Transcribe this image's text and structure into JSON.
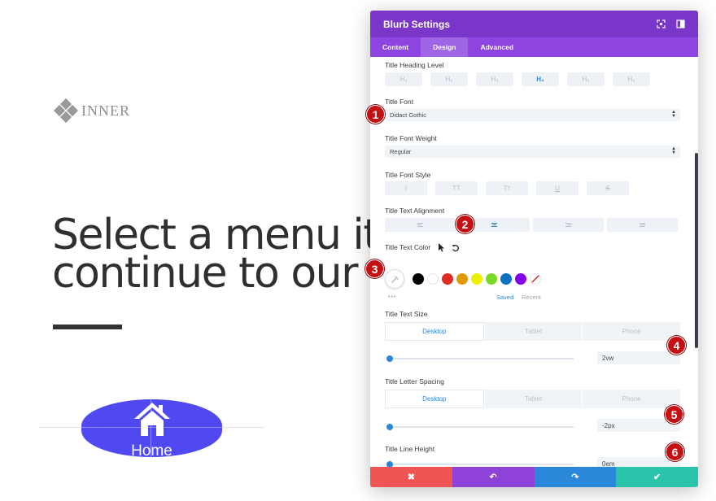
{
  "background": {
    "logo_text": "INNER",
    "headline_line1": "Select a menu it",
    "headline_line2": "continue to our",
    "home_button_label": "Home"
  },
  "modal": {
    "title": "Blurb Settings",
    "header_icons": [
      "expand-icon",
      "sidebar-toggle-icon"
    ],
    "tabs": [
      {
        "label": "Content",
        "active": false
      },
      {
        "label": "Design",
        "active": true
      },
      {
        "label": "Advanced",
        "active": false
      }
    ],
    "title_heading_level": {
      "label": "Title Heading Level",
      "options": [
        "H₁",
        "H₂",
        "H₃",
        "H₄",
        "H₅",
        "H₆"
      ],
      "selected_index": 3
    },
    "title_font": {
      "label": "Title Font",
      "value": "Didact Gothic"
    },
    "title_font_weight": {
      "label": "Title Font Weight",
      "value": "Regular"
    },
    "title_font_style": {
      "label": "Title Font Style",
      "options": [
        "I",
        "TT",
        "Tᴛ",
        "U",
        "S"
      ]
    },
    "title_text_alignment": {
      "label": "Title Text Alignment",
      "options": [
        "left",
        "center",
        "right",
        "justify"
      ],
      "selected": "center"
    },
    "title_text_color": {
      "label": "Title Text Color",
      "swatches": [
        "#000000",
        "#ffffff",
        "#e02b20",
        "#e09900",
        "#edf000",
        "#7cda24",
        "#0c71c3",
        "#8300e9"
      ],
      "more": "•••",
      "saved_label": "Saved",
      "recent_label": "Recent"
    },
    "title_text_size": {
      "label": "Title Text Size",
      "device_tabs": [
        "Desktop",
        "Tablet",
        "Phone"
      ],
      "value": "2vw"
    },
    "title_letter_spacing": {
      "label": "Title Letter Spacing",
      "device_tabs": [
        "Desktop",
        "Tablet",
        "Phone"
      ],
      "value": "-2px"
    },
    "title_line_height": {
      "label": "Title Line Height",
      "value": "0em"
    },
    "footer": {
      "cancel": "✖",
      "undo": "↶",
      "redo": "↷",
      "save": "✔",
      "colors": [
        "#ef5555",
        "#8f42d8",
        "#2b87da",
        "#29c4a9"
      ]
    }
  },
  "markers": [
    "1",
    "2",
    "3",
    "4",
    "5",
    "6"
  ],
  "colors": {
    "header": "#7a36c8",
    "tabs": "#8e44e0",
    "accent_blue": "#2b87da",
    "marker_red": "#c60f13",
    "home_button": "#5049f2"
  }
}
